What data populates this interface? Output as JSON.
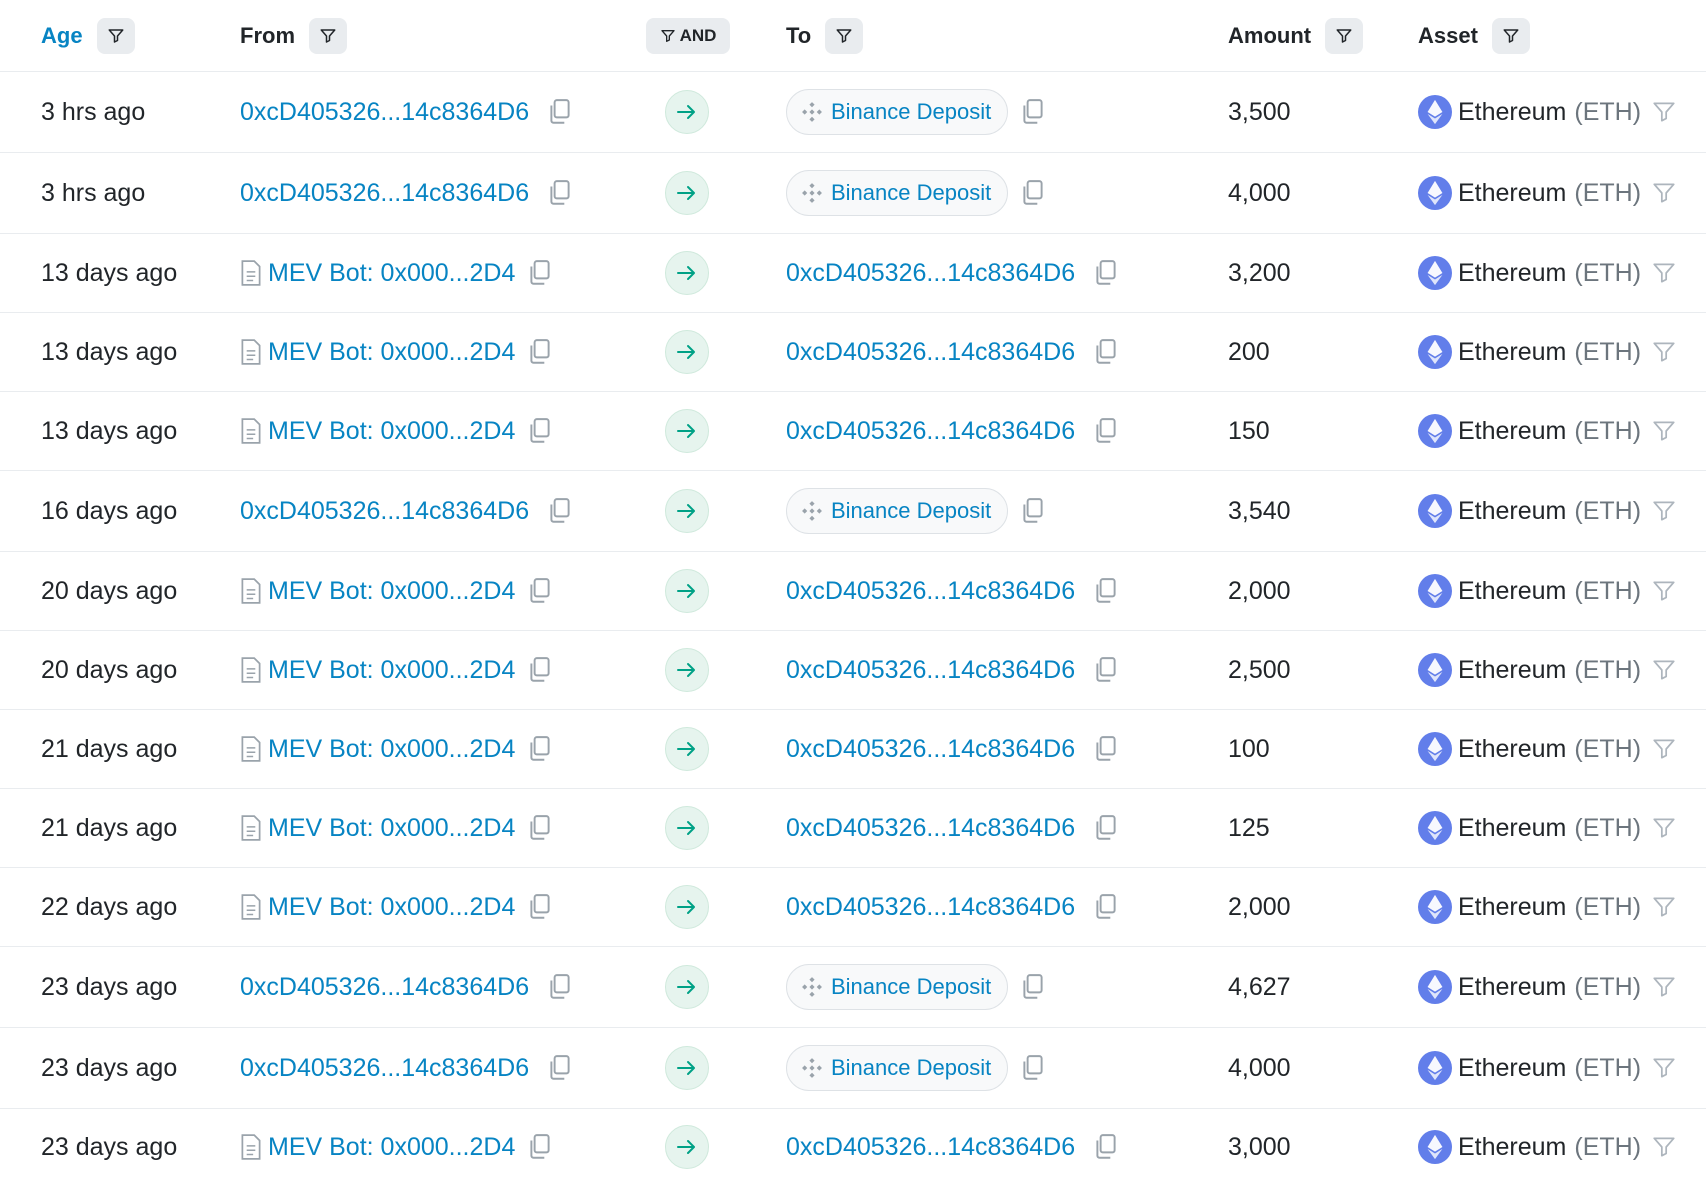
{
  "header": {
    "age": "Age",
    "from": "From",
    "and": "AND",
    "to": "To",
    "amount": "Amount",
    "asset": "Asset"
  },
  "rows": [
    {
      "age": "3 hrs ago",
      "from": "0xcD405326...14c8364D6",
      "from_type": "address",
      "to": "Binance Deposit",
      "to_type": "exchange",
      "amount": "3,500",
      "asset_name": "Ethereum",
      "asset_symbol": "(ETH)"
    },
    {
      "age": "3 hrs ago",
      "from": "0xcD405326...14c8364D6",
      "from_type": "address",
      "to": "Binance Deposit",
      "to_type": "exchange",
      "amount": "4,000",
      "asset_name": "Ethereum",
      "asset_symbol": "(ETH)"
    },
    {
      "age": "13 days ago",
      "from": "MEV Bot: 0x000...2D4",
      "from_type": "contract",
      "to": "0xcD405326...14c8364D6",
      "to_type": "address",
      "amount": "3,200",
      "asset_name": "Ethereum",
      "asset_symbol": "(ETH)"
    },
    {
      "age": "13 days ago",
      "from": "MEV Bot: 0x000...2D4",
      "from_type": "contract",
      "to": "0xcD405326...14c8364D6",
      "to_type": "address",
      "amount": "200",
      "asset_name": "Ethereum",
      "asset_symbol": "(ETH)"
    },
    {
      "age": "13 days ago",
      "from": "MEV Bot: 0x000...2D4",
      "from_type": "contract",
      "to": "0xcD405326...14c8364D6",
      "to_type": "address",
      "amount": "150",
      "asset_name": "Ethereum",
      "asset_symbol": "(ETH)"
    },
    {
      "age": "16 days ago",
      "from": "0xcD405326...14c8364D6",
      "from_type": "address",
      "to": "Binance Deposit",
      "to_type": "exchange",
      "amount": "3,540",
      "asset_name": "Ethereum",
      "asset_symbol": "(ETH)"
    },
    {
      "age": "20 days ago",
      "from": "MEV Bot: 0x000...2D4",
      "from_type": "contract",
      "to": "0xcD405326...14c8364D6",
      "to_type": "address",
      "amount": "2,000",
      "asset_name": "Ethereum",
      "asset_symbol": "(ETH)"
    },
    {
      "age": "20 days ago",
      "from": "MEV Bot: 0x000...2D4",
      "from_type": "contract",
      "to": "0xcD405326...14c8364D6",
      "to_type": "address",
      "amount": "2,500",
      "asset_name": "Ethereum",
      "asset_symbol": "(ETH)"
    },
    {
      "age": "21 days ago",
      "from": "MEV Bot: 0x000...2D4",
      "from_type": "contract",
      "to": "0xcD405326...14c8364D6",
      "to_type": "address",
      "amount": "100",
      "asset_name": "Ethereum",
      "asset_symbol": "(ETH)"
    },
    {
      "age": "21 days ago",
      "from": "MEV Bot: 0x000...2D4",
      "from_type": "contract",
      "to": "0xcD405326...14c8364D6",
      "to_type": "address",
      "amount": "125",
      "asset_name": "Ethereum",
      "asset_symbol": "(ETH)"
    },
    {
      "age": "22 days ago",
      "from": "MEV Bot: 0x000...2D4",
      "from_type": "contract",
      "to": "0xcD405326...14c8364D6",
      "to_type": "address",
      "amount": "2,000",
      "asset_name": "Ethereum",
      "asset_symbol": "(ETH)"
    },
    {
      "age": "23 days ago",
      "from": "0xcD405326...14c8364D6",
      "from_type": "address",
      "to": "Binance Deposit",
      "to_type": "exchange",
      "amount": "4,627",
      "asset_name": "Ethereum",
      "asset_symbol": "(ETH)"
    },
    {
      "age": "23 days ago",
      "from": "0xcD405326...14c8364D6",
      "from_type": "address",
      "to": "Binance Deposit",
      "to_type": "exchange",
      "amount": "4,000",
      "asset_name": "Ethereum",
      "asset_symbol": "(ETH)"
    },
    {
      "age": "23 days ago",
      "from": "MEV Bot: 0x000...2D4",
      "from_type": "contract",
      "to": "0xcD405326...14c8364D6",
      "to_type": "address",
      "amount": "3,000",
      "asset_name": "Ethereum",
      "asset_symbol": "(ETH)"
    }
  ],
  "colors": {
    "link": "#0784c3",
    "text": "#212529",
    "muted": "#6c757d",
    "eth": "#627eea",
    "arrow_bg": "#e6f4ee",
    "arrow_fg": "#00a186"
  },
  "icons": {
    "filter": "filter-icon",
    "copy": "copy-icon",
    "contract": "document-icon",
    "direction": "arrow-right-icon",
    "exchange": "binance-icon",
    "asset": "ethereum-icon"
  }
}
